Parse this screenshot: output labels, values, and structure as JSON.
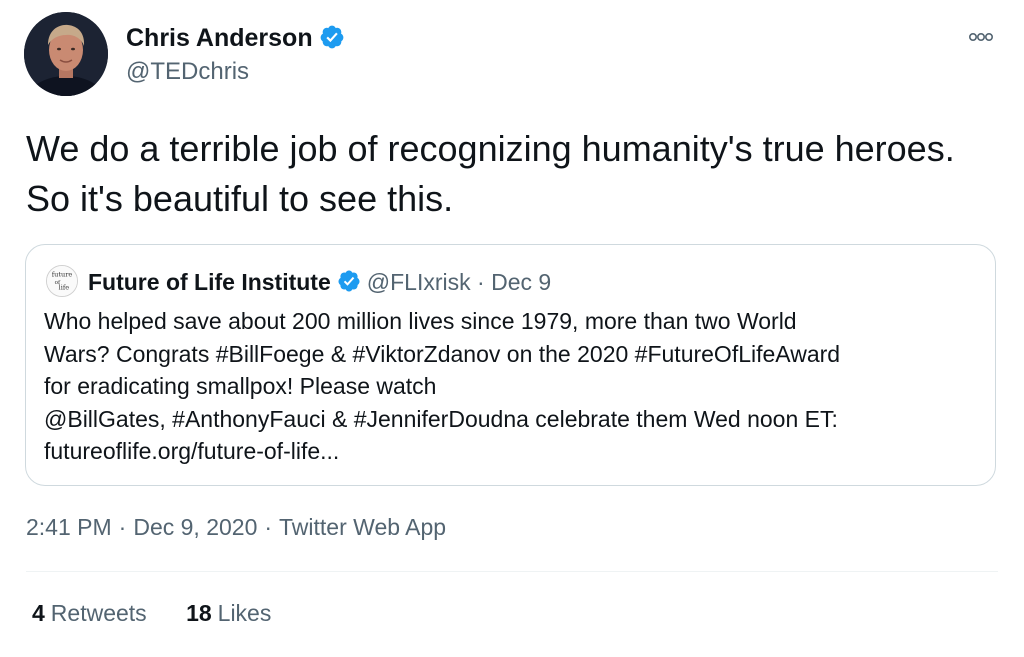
{
  "author": {
    "name": "Chris Anderson",
    "handle": "@TEDchris",
    "verified": true
  },
  "tweet": {
    "text": "We do a terrible job of recognizing humanity's true heroes. So it's beautiful to see this."
  },
  "quoted_tweet": {
    "name": "Future of Life Institute",
    "handle": "@FLIxrisk",
    "separator": "·",
    "date": "Dec 9",
    "logo_text": [
      "future",
      "of",
      "life"
    ],
    "lines": [
      "Who helped save about 200 million lives since 1979, more than two World",
      "Wars? Congrats #BillFoege & #ViktorZdanov on the 2020 #FutureOfLifeAward",
      "for eradicating smallpox! Please watch",
      "@BillGates, #AnthonyFauci & #JenniferDoudna celebrate them Wed noon ET:",
      "futureoflife.org/future-of-life..."
    ]
  },
  "meta": {
    "time": "2:41 PM",
    "date": "Dec 9, 2020",
    "source": "Twitter Web App",
    "separator": "·"
  },
  "stats": {
    "retweets_count": "4",
    "retweets_label": "Retweets",
    "likes_count": "18",
    "likes_label": "Likes"
  },
  "colors": {
    "verified_blue": "#1d9bf0",
    "secondary_text": "#536471",
    "border": "#cfd9de"
  },
  "icons": {
    "verified": "verified-badge-icon",
    "more": "more-options-icon"
  }
}
